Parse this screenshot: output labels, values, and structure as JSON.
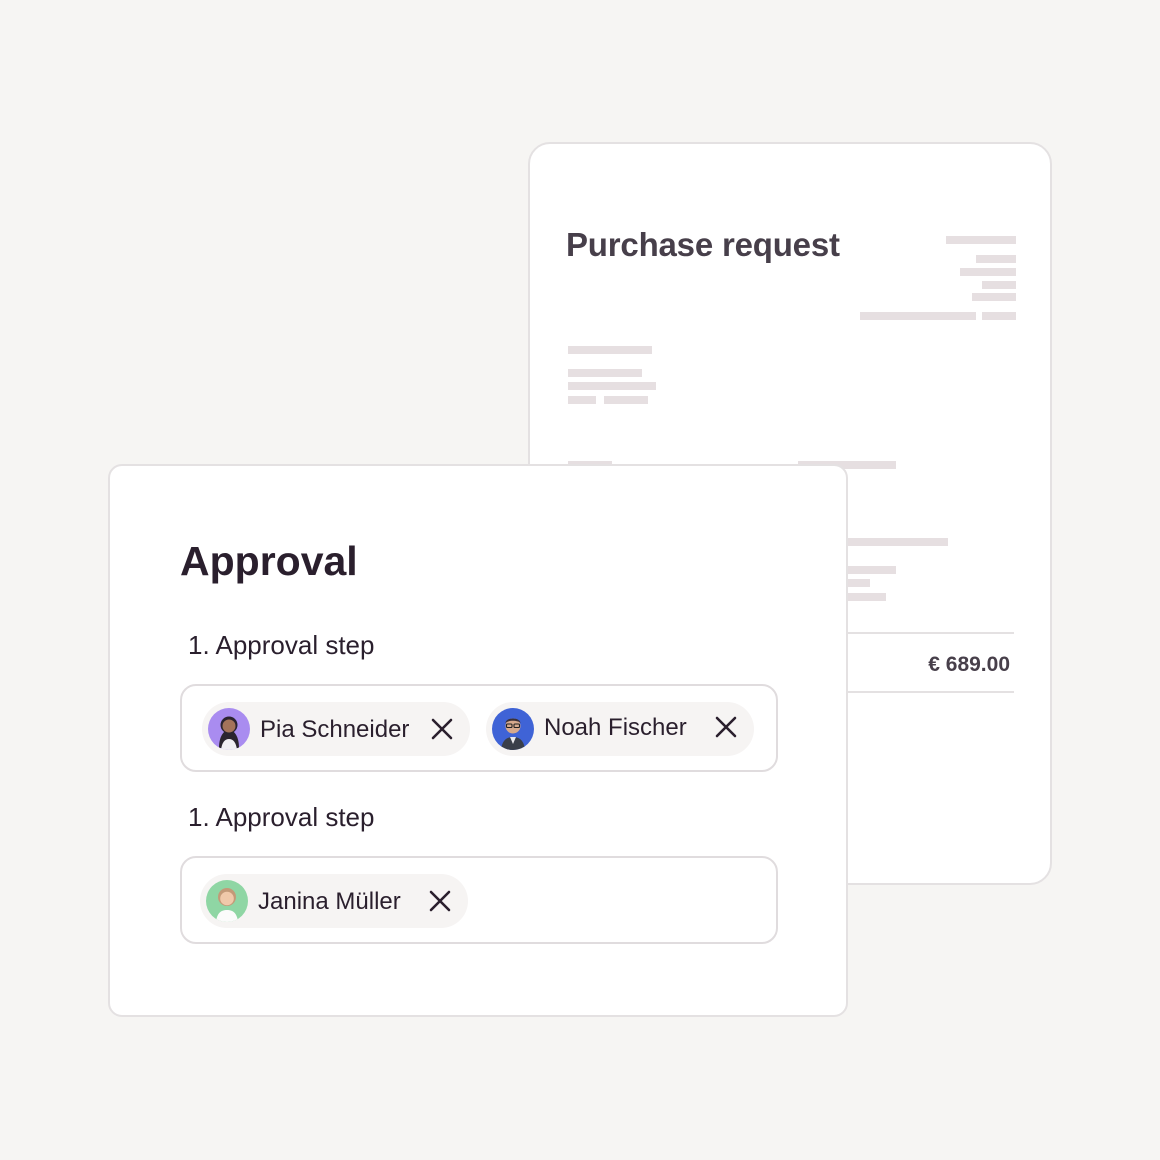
{
  "purchase_request": {
    "title": "Purchase request",
    "total": "€ 689.00"
  },
  "approval": {
    "title": "Approval",
    "steps": [
      {
        "label": "1. Approval step",
        "approvers": [
          {
            "name": "Pia Schneider",
            "avatar_color": "#a98cf0",
            "remove_icon": "close-icon"
          },
          {
            "name": "Noah Fischer",
            "avatar_color": "#3f63d6",
            "remove_icon": "close-icon"
          }
        ]
      },
      {
        "label": "1. Approval step",
        "approvers": [
          {
            "name": "Janina Müller",
            "avatar_color": "#8fd6a4",
            "remove_icon": "close-icon"
          }
        ]
      }
    ]
  },
  "colors": {
    "background": "#f6f5f3",
    "card": "#ffffff",
    "text_primary": "#2a1f2d",
    "text_secondary": "#473f4a",
    "placeholder": "#e6dfe1",
    "chip": "#f6f4f3"
  }
}
